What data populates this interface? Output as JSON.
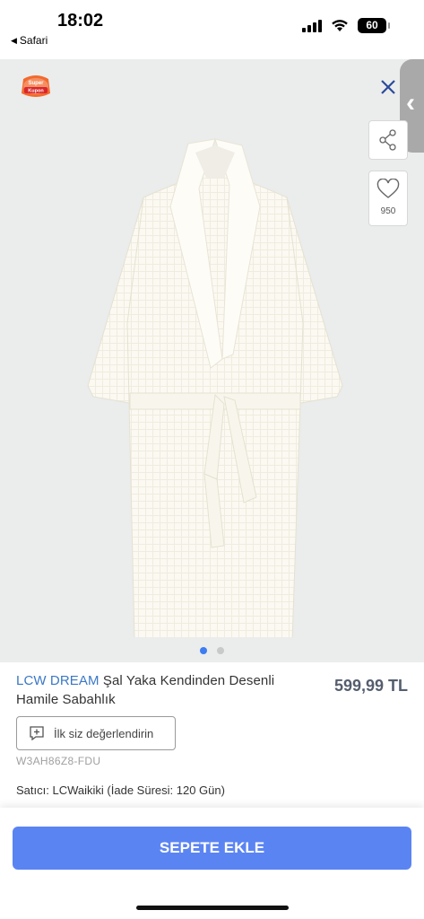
{
  "status_bar": {
    "time": "18:02",
    "back_label": "Safari",
    "battery": "60"
  },
  "product": {
    "badge_line1": "Super",
    "badge_line2": "Kupon",
    "favorite_count": "950",
    "image_count": 2,
    "active_image": 1,
    "brand": "LCW DREAM",
    "name": "Şal Yaka Kendinden Desenli Hamile Sabahlık",
    "price": "599,99 TL",
    "review_label": "İlk siz değerlendirin",
    "sku": "W3AH86Z8-FDU",
    "seller_label": "Satıcı:",
    "seller_name": "LCWaikiki",
    "return_info": "(İade Süresi: 120 Gün)"
  },
  "actions": {
    "add_to_cart": "SEPETE EKLE"
  },
  "colors": {
    "accent": "#5b84f3",
    "brand_link": "#3a78c6",
    "close_icon": "#2b4a9a"
  },
  "icons": [
    "super-kupon-badge-icon",
    "close-icon",
    "share-icon",
    "heart-icon",
    "plus-square-icon"
  ]
}
